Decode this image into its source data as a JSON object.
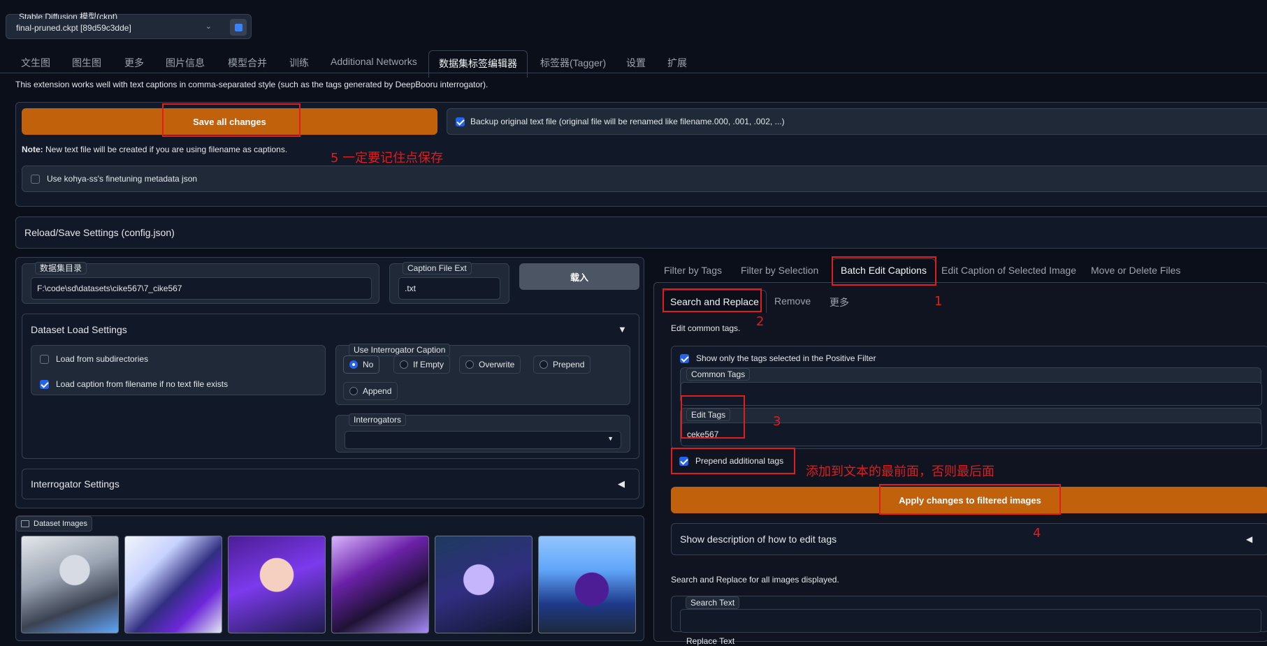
{
  "model": {
    "label": "Stable Diffusion 模型(ckpt)",
    "value": "final-pruned.ckpt [89d59c3dde]"
  },
  "main_tabs": [
    "文生图",
    "图生图",
    "更多",
    "图片信息",
    "模型合并",
    "训练",
    "Additional Networks",
    "数据集标签编辑器",
    "标签器(Tagger)",
    "设置",
    "扩展"
  ],
  "intro": "This extension works well with text captions in comma-separated style (such as the tags generated by DeepBooru interrogator).",
  "save_button": "Save all changes",
  "backup_label": "Backup original text file (original file will be renamed like filename.000, .001, .002, ...)",
  "note_bold": "Note:",
  "note_text": " New text file will be created if you are using filename as captions.",
  "kohya_label": "Use kohya-ss's finetuning metadata json",
  "reload_settings": "Reload/Save Settings (config.json)",
  "dataset_dir": {
    "label": "数据集目录",
    "value": "F:\\code\\sd\\datasets\\cike567\\7_cike567"
  },
  "caption_ext": {
    "label": "Caption File Ext",
    "value": ".txt"
  },
  "load_button": "载入",
  "dataset_load_settings": "Dataset Load Settings",
  "load_subdirs": "Load from subdirectories",
  "load_caption_filename": "Load caption from filename if no text file exists",
  "interrogator_caption": {
    "label": "Use Interrogator Caption",
    "options": [
      "No",
      "If Empty",
      "Overwrite",
      "Prepend",
      "Append"
    ],
    "selected": "No"
  },
  "interrogators_label": "Interrogators",
  "interrogator_settings": "Interrogator Settings",
  "dataset_images_label": "Dataset Images",
  "right_tabs": [
    "Filter by Tags",
    "Filter by Selection",
    "Batch Edit Captions",
    "Edit Caption of Selected Image",
    "Move or Delete Files"
  ],
  "sub_tabs": [
    "Search and Replace",
    "Remove",
    "更多"
  ],
  "edit_common_tags": "Edit common tags.",
  "show_only_selected": "Show only the tags selected in the Positive Filter",
  "common_tags_label": "Common Tags",
  "edit_tags": {
    "label": "Edit Tags",
    "value": "ceke567"
  },
  "prepend_label": "Prepend additional tags",
  "apply_button": "Apply changes to filtered images",
  "show_description": "Show description of how to edit tags",
  "search_replace_desc": "Search and Replace for all images displayed.",
  "search_text_label": "Search Text",
  "replace_text_label": "Replace Text",
  "annotations": {
    "a1": "1",
    "a2": "2",
    "a3": "3",
    "a4": "4",
    "a5": "5 一定要记住点保存",
    "prepend_note": "添加到文本的最前面，否则最后面"
  },
  "colors": {
    "accent_orange": "#c2610c",
    "annotation_red": "#e11d1d",
    "checkbox_blue": "#2563eb"
  }
}
